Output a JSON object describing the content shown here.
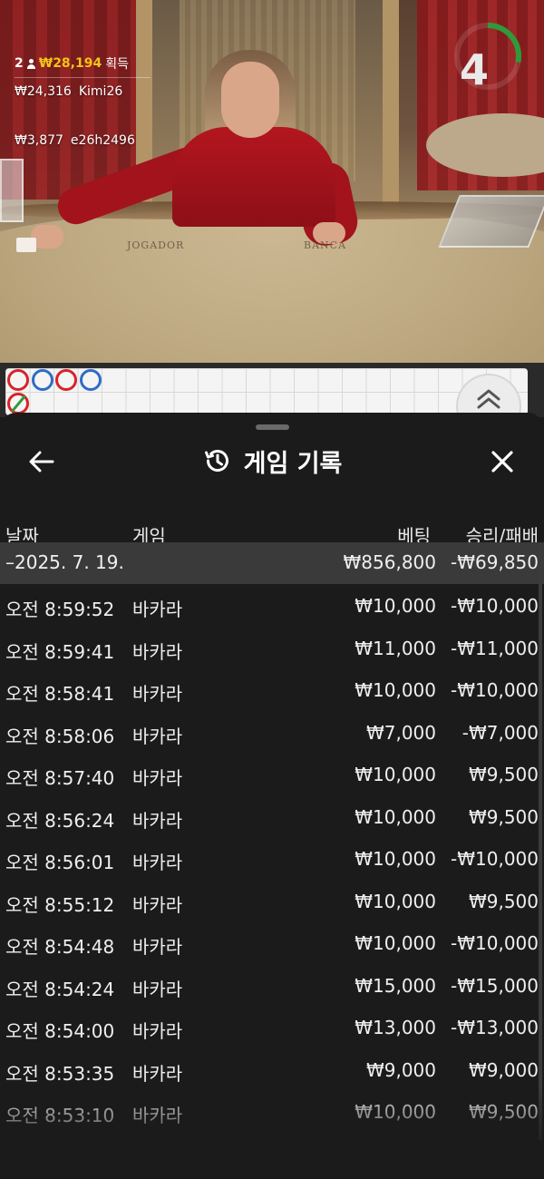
{
  "winners": {
    "count": "2",
    "total": "₩28,194",
    "total_suffix": "획득",
    "list": [
      {
        "amount": "₩24,316",
        "name": "Kimi26"
      },
      {
        "amount": "₩3,877",
        "name": "e26h2496"
      }
    ]
  },
  "timer": {
    "value": "4",
    "progress": 0.28,
    "color": "#2e9a3a"
  },
  "table_labels": {
    "player": "JOGADOR",
    "banker": "BANCA"
  },
  "road_beads": [
    {
      "color": "red",
      "slash": false
    },
    {
      "color": "blue",
      "slash": false
    },
    {
      "color": "red",
      "slash": false
    },
    {
      "color": "blue",
      "slash": false
    },
    {
      "color": "red",
      "slash": true
    }
  ],
  "history": {
    "title": "게임 기록",
    "icons": {
      "back": "back-arrow-icon",
      "history": "history-icon",
      "close": "close-icon",
      "road_toggle": "chevron-up-icon"
    },
    "columns": {
      "date": "날짜",
      "game": "게임",
      "bet": "베팅",
      "result": "승리/패배"
    },
    "date_group": {
      "date": "–2025. 7. 19.",
      "bet": "₩856,800",
      "result": "-₩69,850"
    },
    "rows": [
      {
        "time": "오전 8:59:52",
        "game": "바카라",
        "bet": "₩10,000",
        "result": "-₩10,000"
      },
      {
        "time": "오전 8:59:41",
        "game": "바카라",
        "bet": "₩11,000",
        "result": "-₩11,000"
      },
      {
        "time": "오전 8:58:41",
        "game": "바카라",
        "bet": "₩10,000",
        "result": "-₩10,000"
      },
      {
        "time": "오전 8:58:06",
        "game": "바카라",
        "bet": "₩7,000",
        "result": "-₩7,000"
      },
      {
        "time": "오전 8:57:40",
        "game": "바카라",
        "bet": "₩10,000",
        "result": "₩9,500"
      },
      {
        "time": "오전 8:56:24",
        "game": "바카라",
        "bet": "₩10,000",
        "result": "₩9,500"
      },
      {
        "time": "오전 8:56:01",
        "game": "바카라",
        "bet": "₩10,000",
        "result": "-₩10,000"
      },
      {
        "time": "오전 8:55:12",
        "game": "바카라",
        "bet": "₩10,000",
        "result": "₩9,500"
      },
      {
        "time": "오전 8:54:48",
        "game": "바카라",
        "bet": "₩10,000",
        "result": "-₩10,000"
      },
      {
        "time": "오전 8:54:24",
        "game": "바카라",
        "bet": "₩15,000",
        "result": "-₩15,000"
      },
      {
        "time": "오전 8:54:00",
        "game": "바카라",
        "bet": "₩13,000",
        "result": "-₩13,000"
      },
      {
        "time": "오전 8:53:35",
        "game": "바카라",
        "bet": "₩9,000",
        "result": "₩9,000"
      },
      {
        "time": "오전 8:53:10",
        "game": "바카라",
        "bet": "₩10,000",
        "result": "₩9,500"
      }
    ]
  }
}
